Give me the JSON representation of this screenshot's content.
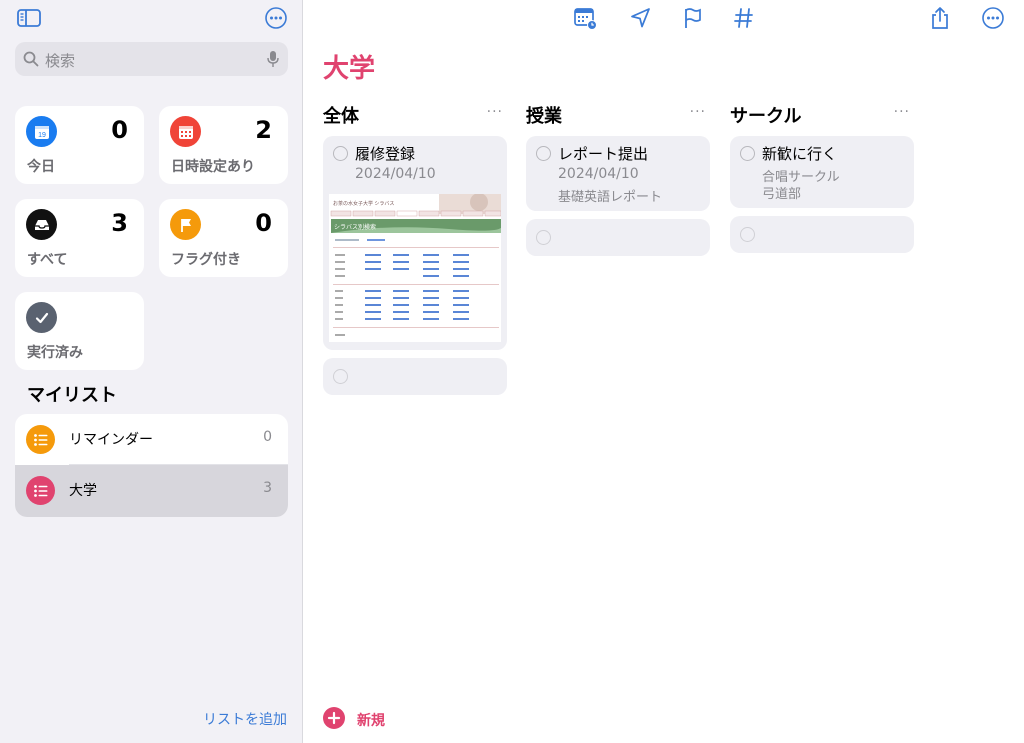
{
  "sidebar": {
    "search": {
      "placeholder": "検索"
    },
    "smart_lists": [
      {
        "label": "今日",
        "count": "0",
        "color": "#1a7cf0",
        "icon": "calendar-today-icon"
      },
      {
        "label": "日時設定あり",
        "count": "2",
        "color": "#f04438",
        "icon": "calendar-grid-icon"
      },
      {
        "label": "すべて",
        "count": "3",
        "color": "#111111",
        "icon": "tray-icon"
      },
      {
        "label": "フラグ付き",
        "count": "0",
        "color": "#f59a0b",
        "icon": "flag-icon"
      },
      {
        "label": "実行済み",
        "count": "",
        "color": "#5a6270",
        "icon": "checkmark-icon"
      }
    ],
    "my_lists_header": "マイリスト",
    "lists": [
      {
        "name": "リマインダー",
        "count": "0",
        "color": "#f59a0b"
      },
      {
        "name": "大学",
        "count": "3",
        "color": "#e0436f"
      }
    ],
    "add_list": "リストを追加",
    "today_badge": "19"
  },
  "main": {
    "title": "大学",
    "accent": "#e0436f",
    "columns": [
      {
        "header": "全体",
        "tasks": [
          {
            "title": "履修登録",
            "date": "2024/04/10",
            "notes": [],
            "has_image": true
          }
        ]
      },
      {
        "header": "授業",
        "tasks": [
          {
            "title": "レポート提出",
            "date": "2024/04/10",
            "notes": [
              "基礎英語レポート"
            ],
            "has_image": false
          }
        ]
      },
      {
        "header": "サークル",
        "tasks": [
          {
            "title": "新歓に行く",
            "date": "",
            "notes": [
              "合唱サークル",
              "弓道部"
            ],
            "has_image": false
          }
        ]
      }
    ],
    "column_more": "···",
    "new_label": "新規",
    "thumbnail_title": "お茶の水女子大学 シラバス",
    "thumbnail_banner": "シラバス別検索"
  }
}
